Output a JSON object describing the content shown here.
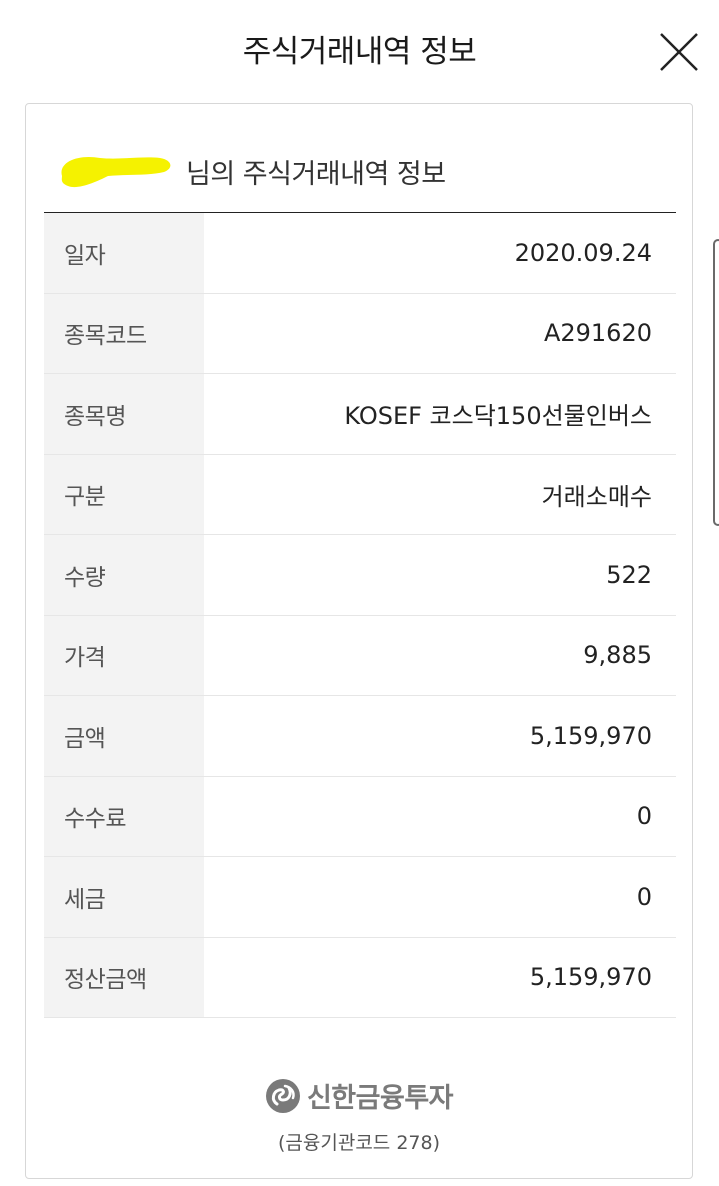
{
  "header": {
    "title": "주식거래내역 정보",
    "close_icon": "close-x-icon"
  },
  "card": {
    "heading_suffix": "님의 주식거래내역 정보",
    "redaction_color": "#f5f200",
    "rows": [
      {
        "label": "일자",
        "value": "2020.09.24"
      },
      {
        "label": "종목코드",
        "value": "A291620"
      },
      {
        "label": "종목명",
        "value": "KOSEF 코스닥150선물인버스"
      },
      {
        "label": "구분",
        "value": "거래소매수"
      },
      {
        "label": "수량",
        "value": "522"
      },
      {
        "label": "가격",
        "value": "9,885"
      },
      {
        "label": "금액",
        "value": "5,159,970"
      },
      {
        "label": "수수료",
        "value": "0"
      },
      {
        "label": "세금",
        "value": "0"
      },
      {
        "label": "정산금액",
        "value": "5,159,970"
      }
    ]
  },
  "footer": {
    "brand": "신한금융투자",
    "brand_icon": "shinhan-logo-icon",
    "institution_code": "(금융기관코드 278)"
  }
}
